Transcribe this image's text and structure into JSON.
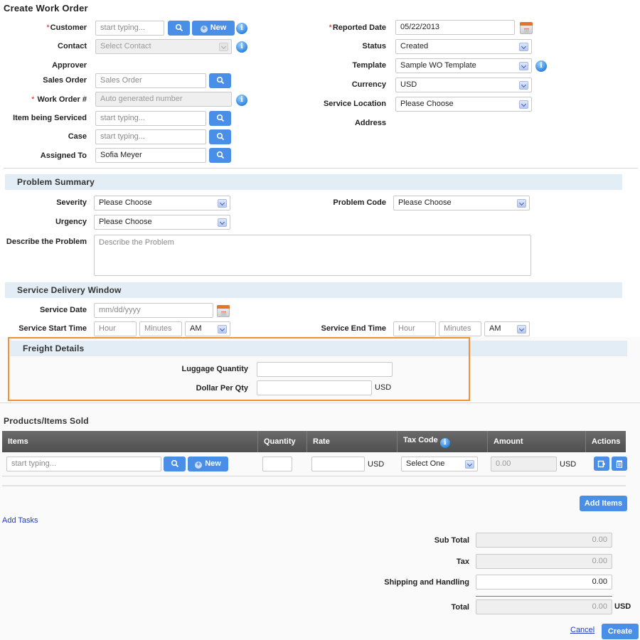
{
  "page": {
    "title": "Create Work Order"
  },
  "header_left": {
    "customer": {
      "label": "Customer",
      "required": "*",
      "placeholder": "start typing...",
      "new_label": "New"
    },
    "contact": {
      "label": "Contact",
      "value": "Select Contact"
    },
    "approver": {
      "label": "Approver"
    },
    "sales_order": {
      "label": "Sales Order",
      "placeholder": "Sales Order"
    },
    "work_order": {
      "label": "Work Order #",
      "required": "*",
      "placeholder": "Auto generated number"
    },
    "item_serviced": {
      "label": "Item being Serviced",
      "placeholder": "start typing..."
    },
    "case": {
      "label": "Case",
      "placeholder": "start typing..."
    },
    "assigned_to": {
      "label": "Assigned To",
      "value": "Sofia Meyer"
    }
  },
  "header_right": {
    "reported_date": {
      "label": "Reported Date",
      "required": "*",
      "value": "05/22/2013"
    },
    "status": {
      "label": "Status",
      "value": "Created"
    },
    "template": {
      "label": "Template",
      "value": "Sample WO Template"
    },
    "currency": {
      "label": "Currency",
      "value": "USD"
    },
    "service_location": {
      "label": "Service Location",
      "value": "Please Choose"
    },
    "address": {
      "label": "Address"
    }
  },
  "problem_summary": {
    "title": "Problem Summary",
    "severity": {
      "label": "Severity",
      "value": "Please Choose"
    },
    "urgency": {
      "label": "Urgency",
      "value": "Please Choose"
    },
    "problem_code": {
      "label": "Problem Code",
      "value": "Please Choose"
    },
    "describe": {
      "label": "Describe the Problem",
      "placeholder": "Describe the Problem"
    }
  },
  "service_delivery": {
    "title": "Service Delivery Window",
    "service_date": {
      "label": "Service Date",
      "placeholder": "mm/dd/yyyy"
    },
    "start_time": {
      "label": "Service Start Time",
      "hour_placeholder": "Hour",
      "minutes_placeholder": "Minutes",
      "ampm": "AM"
    },
    "end_time": {
      "label": "Service End Time",
      "hour_placeholder": "Hour",
      "minutes_placeholder": "Minutes",
      "ampm": "AM"
    }
  },
  "freight": {
    "title": "Freight Details",
    "luggage_quantity": {
      "label": "Luggage Quantity",
      "value": ""
    },
    "dollar_per_qty": {
      "label": "Dollar Per Qty",
      "value": "",
      "unit": "USD"
    },
    "highlight_color": "#f0913a"
  },
  "products": {
    "title": "Products/Items Sold",
    "columns": [
      "Items",
      "Quantity",
      "Rate",
      "Tax Code",
      "Amount",
      "Actions"
    ],
    "row": {
      "item_placeholder": "start typing...",
      "new_label": "New",
      "quantity": "",
      "rate": "",
      "rate_unit": "USD",
      "tax_code": "Select One",
      "amount": "0.00",
      "amount_unit": "USD"
    },
    "add_items_label": "Add Items"
  },
  "add_tasks_label": "Add Tasks",
  "totals": {
    "sub_total": {
      "label": "Sub Total",
      "value": "0.00"
    },
    "tax": {
      "label": "Tax",
      "value": "0.00"
    },
    "shipping": {
      "label": "Shipping and Handling",
      "value": "0.00"
    },
    "total": {
      "label": "Total",
      "value": "0.00",
      "unit": "USD"
    }
  },
  "footer": {
    "cancel_label": "Cancel",
    "create_label": "Create"
  },
  "colors": {
    "primary_button": "#4a8fe7",
    "section_bar": "#e3edf6",
    "table_header": "#5a5a5a",
    "link": "#1a3cc8"
  }
}
